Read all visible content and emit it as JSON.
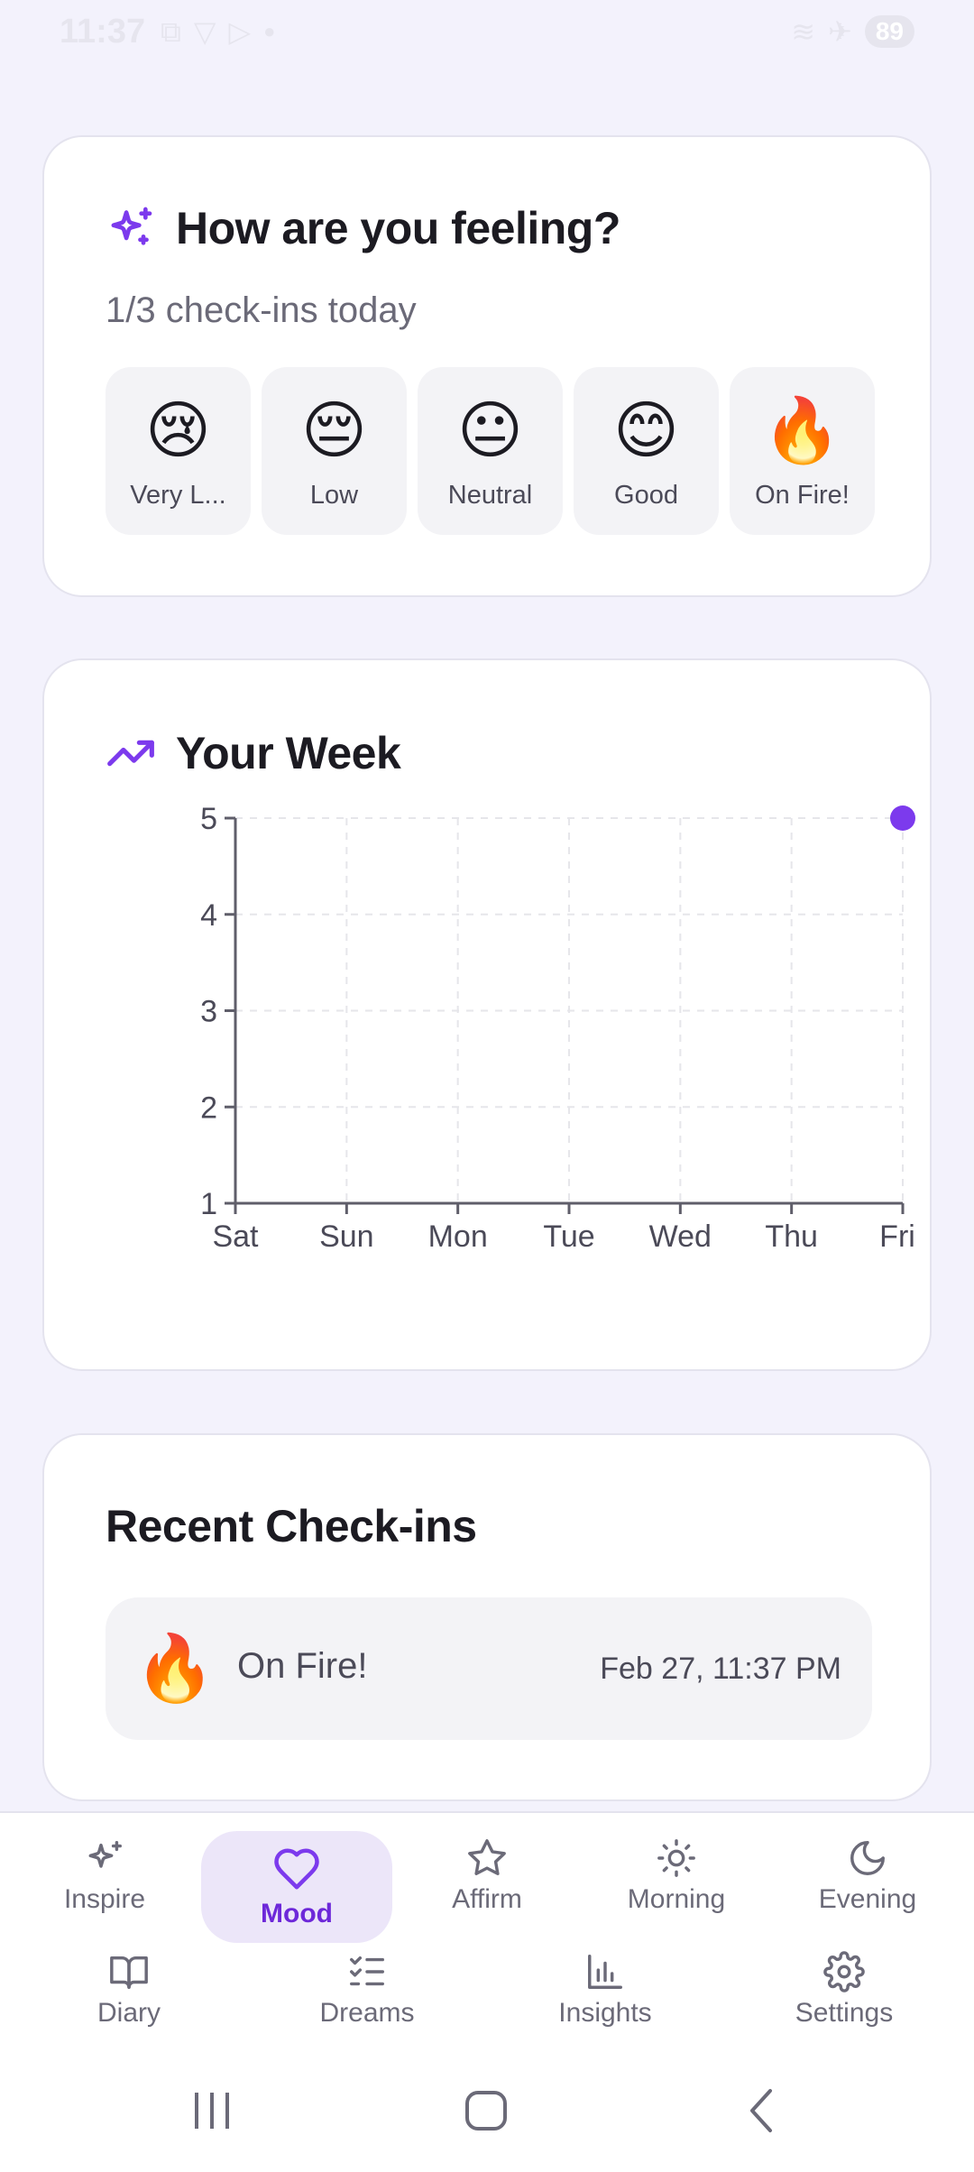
{
  "status_bar": {
    "time": "11:37",
    "battery": "89"
  },
  "mood_card": {
    "title": "How are you feeling?",
    "subtitle": "1/3 check-ins today",
    "options": [
      {
        "emoji": "😢",
        "label": "Very L..."
      },
      {
        "emoji": "😔",
        "label": "Low"
      },
      {
        "emoji": "😐",
        "label": "Neutral"
      },
      {
        "emoji": "😊",
        "label": "Good"
      },
      {
        "emoji": "🔥",
        "label": "On Fire!"
      }
    ]
  },
  "week_card": {
    "title": "Your Week"
  },
  "chart_data": {
    "type": "scatter",
    "title": "Your Week",
    "categories": [
      "Sat",
      "Sun",
      "Mon",
      "Tue",
      "Wed",
      "Thu",
      "Fri"
    ],
    "y_ticks": [
      "1",
      "2",
      "3",
      "4",
      "5"
    ],
    "ylim": [
      1,
      5
    ],
    "grid": true,
    "series": [
      {
        "values": [
          null,
          null,
          null,
          null,
          null,
          null,
          5
        ],
        "color": "#7c3aed"
      }
    ]
  },
  "recent_card": {
    "title": "Recent Check-ins",
    "items": [
      {
        "emoji": "🔥",
        "label": "On Fire!",
        "time": "Feb 27, 11:37 PM"
      }
    ]
  },
  "bottom_nav": {
    "row1": [
      {
        "label": "Inspire",
        "icon": "sparkles-icon"
      },
      {
        "label": "Mood",
        "icon": "heart-icon",
        "active": true
      },
      {
        "label": "Affirm",
        "icon": "star-icon"
      },
      {
        "label": "Morning",
        "icon": "sun-icon"
      },
      {
        "label": "Evening",
        "icon": "moon-icon"
      }
    ],
    "row2": [
      {
        "label": "Diary",
        "icon": "book-icon"
      },
      {
        "label": "Dreams",
        "icon": "list-checks-icon"
      },
      {
        "label": "Insights",
        "icon": "bar-chart-icon"
      },
      {
        "label": "Settings",
        "icon": "gear-icon"
      }
    ]
  },
  "colors": {
    "accent": "#7c3aed",
    "background": "#f3f2fc",
    "active_tab_bg": "#ece6f9"
  }
}
